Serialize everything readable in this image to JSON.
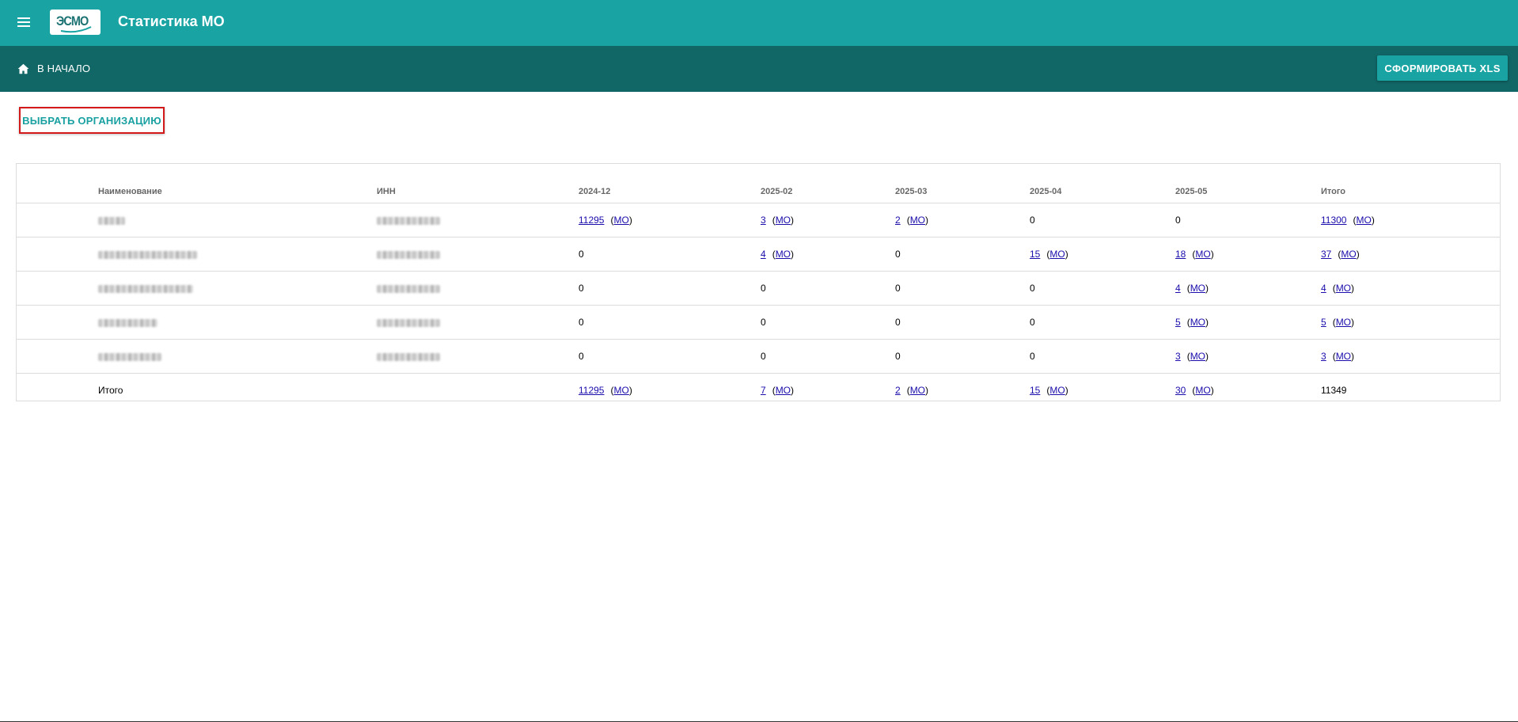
{
  "appbar": {
    "title": "Статистика МО",
    "logo_text": "ЭСМО",
    "menu_icon": "menu-icon"
  },
  "subbar": {
    "home_label": "В НАЧАЛО",
    "home_icon": "home-icon",
    "xls_button": "СФОРМИРОВАТЬ XLS"
  },
  "org_button": "ВЫБРАТЬ ОРГАНИЗАЦИЮ",
  "table": {
    "headers": [
      "Наименование",
      "ИНН",
      "2024-12",
      "2025-02",
      "2025-03",
      "2025-04",
      "2025-05",
      "Итого"
    ],
    "mo_label": "МО",
    "rows": [
      {
        "name_redacted": true,
        "inn_redacted": true,
        "cells": [
          {
            "v": "11295",
            "link": true
          },
          {
            "v": "3",
            "link": true
          },
          {
            "v": "2",
            "link": true
          },
          {
            "v": "0",
            "link": false
          },
          {
            "v": "0",
            "link": false
          },
          {
            "v": "11300",
            "link": true
          }
        ]
      },
      {
        "name_redacted": true,
        "inn_redacted": true,
        "cells": [
          {
            "v": "0",
            "link": false
          },
          {
            "v": "4",
            "link": true
          },
          {
            "v": "0",
            "link": false
          },
          {
            "v": "15",
            "link": true
          },
          {
            "v": "18",
            "link": true
          },
          {
            "v": "37",
            "link": true
          }
        ]
      },
      {
        "name_redacted": true,
        "inn_redacted": true,
        "cells": [
          {
            "v": "0",
            "link": false
          },
          {
            "v": "0",
            "link": false
          },
          {
            "v": "0",
            "link": false
          },
          {
            "v": "0",
            "link": false
          },
          {
            "v": "4",
            "link": true
          },
          {
            "v": "4",
            "link": true
          }
        ]
      },
      {
        "name_redacted": true,
        "inn_redacted": true,
        "cells": [
          {
            "v": "0",
            "link": false
          },
          {
            "v": "0",
            "link": false
          },
          {
            "v": "0",
            "link": false
          },
          {
            "v": "0",
            "link": false
          },
          {
            "v": "5",
            "link": true
          },
          {
            "v": "5",
            "link": true
          }
        ]
      },
      {
        "name_redacted": true,
        "inn_redacted": true,
        "cells": [
          {
            "v": "0",
            "link": false
          },
          {
            "v": "0",
            "link": false
          },
          {
            "v": "0",
            "link": false
          },
          {
            "v": "0",
            "link": false
          },
          {
            "v": "3",
            "link": true
          },
          {
            "v": "3",
            "link": true
          }
        ]
      }
    ],
    "total_row": {
      "label": "Итого",
      "cells": [
        {
          "v": "11295",
          "link": true
        },
        {
          "v": "7",
          "link": true
        },
        {
          "v": "2",
          "link": true
        },
        {
          "v": "15",
          "link": true
        },
        {
          "v": "30",
          "link": true
        },
        {
          "v": "11349",
          "link": false
        }
      ]
    }
  },
  "colors": {
    "appbar": "#19a3a3",
    "subbar": "#116666",
    "accent": "#19a0a0",
    "highlight_border": "#d21a1a",
    "link": "#1a0dab"
  }
}
